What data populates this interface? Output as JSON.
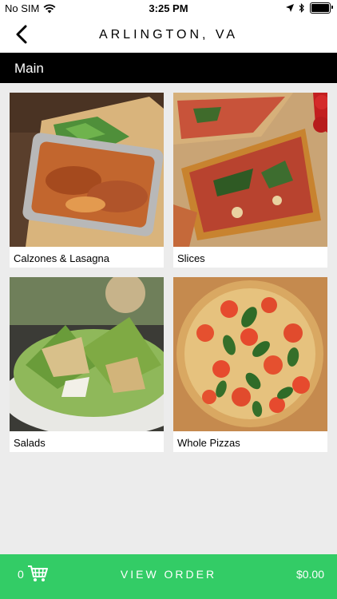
{
  "status_bar": {
    "carrier": "No SIM",
    "time": "3:25 PM",
    "icons": [
      "wifi-icon",
      "location-arrow-icon",
      "bluetooth-icon",
      "battery-icon"
    ]
  },
  "header": {
    "title": "ARLINGTON, VA",
    "back_icon": "chevron-left-icon"
  },
  "section": {
    "title": "Main"
  },
  "categories": [
    {
      "label": "Calzones & Lasagna",
      "image": "lasagna-tray-photo"
    },
    {
      "label": "Slices",
      "image": "pizza-slices-photo"
    },
    {
      "label": "Salads",
      "image": "caesar-salad-photo"
    },
    {
      "label": "Whole Pizzas",
      "image": "margherita-pizza-photo"
    }
  ],
  "bottom_bar": {
    "cart_count": "0",
    "cart_icon": "shopping-cart-icon",
    "view_order_label": "VIEW ORDER",
    "total": "$0.00",
    "color": "#33cc66"
  }
}
